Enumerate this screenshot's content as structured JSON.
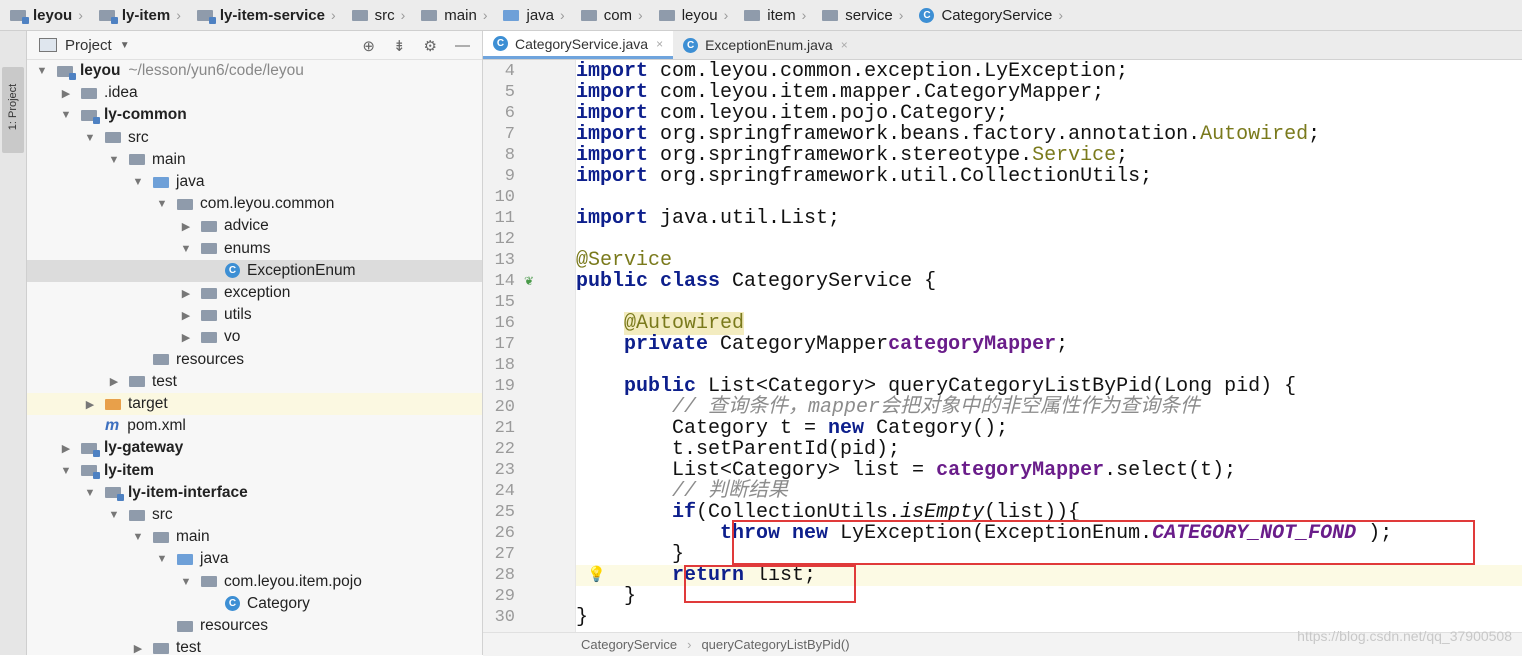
{
  "breadcrumb": [
    "leyou",
    "ly-item",
    "ly-item-service",
    "src",
    "main",
    "java",
    "com",
    "leyou",
    "item",
    "service",
    "CategoryService"
  ],
  "tool_strip": {
    "label": "1: Project"
  },
  "project_panel": {
    "title": "Project",
    "tree": [
      {
        "label": "leyou",
        "path": "~/lesson/yun6/code/leyou",
        "depth": 0,
        "arrow": "down",
        "icon": "module-folder",
        "bold": true
      },
      {
        "label": ".idea",
        "depth": 1,
        "arrow": "right",
        "icon": "folder"
      },
      {
        "label": "ly-common",
        "depth": 1,
        "arrow": "down",
        "icon": "module-folder",
        "bold": true
      },
      {
        "label": "src",
        "depth": 2,
        "arrow": "down",
        "icon": "folder"
      },
      {
        "label": "main",
        "depth": 3,
        "arrow": "down",
        "icon": "folder"
      },
      {
        "label": "java",
        "depth": 4,
        "arrow": "down",
        "icon": "source-folder"
      },
      {
        "label": "com.leyou.common",
        "depth": 5,
        "arrow": "down",
        "icon": "package"
      },
      {
        "label": "advice",
        "depth": 6,
        "arrow": "right",
        "icon": "package"
      },
      {
        "label": "enums",
        "depth": 6,
        "arrow": "down",
        "icon": "package"
      },
      {
        "label": "ExceptionEnum",
        "depth": 7,
        "arrow": "",
        "icon": "class",
        "selected": true
      },
      {
        "label": "exception",
        "depth": 6,
        "arrow": "right",
        "icon": "package"
      },
      {
        "label": "utils",
        "depth": 6,
        "arrow": "right",
        "icon": "package"
      },
      {
        "label": "vo",
        "depth": 6,
        "arrow": "right",
        "icon": "package"
      },
      {
        "label": "resources",
        "depth": 4,
        "arrow": "",
        "icon": "folder"
      },
      {
        "label": "test",
        "depth": 3,
        "arrow": "right",
        "icon": "folder"
      },
      {
        "label": "target",
        "depth": 2,
        "arrow": "right",
        "icon": "target-folder",
        "highlight": true
      },
      {
        "label": "pom.xml",
        "depth": 2,
        "arrow": "",
        "icon": "maven"
      },
      {
        "label": "ly-gateway",
        "depth": 1,
        "arrow": "right",
        "icon": "module-folder",
        "bold": true
      },
      {
        "label": "ly-item",
        "depth": 1,
        "arrow": "down",
        "icon": "module-folder",
        "bold": true
      },
      {
        "label": "ly-item-interface",
        "depth": 2,
        "arrow": "down",
        "icon": "module-folder",
        "bold": true
      },
      {
        "label": "src",
        "depth": 3,
        "arrow": "down",
        "icon": "folder"
      },
      {
        "label": "main",
        "depth": 4,
        "arrow": "down",
        "icon": "folder"
      },
      {
        "label": "java",
        "depth": 5,
        "arrow": "down",
        "icon": "source-folder"
      },
      {
        "label": "com.leyou.item.pojo",
        "depth": 6,
        "arrow": "down",
        "icon": "package"
      },
      {
        "label": "Category",
        "depth": 7,
        "arrow": "",
        "icon": "class"
      },
      {
        "label": "resources",
        "depth": 5,
        "arrow": "",
        "icon": "folder"
      },
      {
        "label": "test",
        "depth": 4,
        "arrow": "right",
        "icon": "folder"
      }
    ]
  },
  "editor": {
    "tabs": [
      {
        "label": "CategoryService.java",
        "active": true
      },
      {
        "label": "ExceptionEnum.java",
        "active": false
      }
    ],
    "lines": [
      {
        "n": "4",
        "tokens": [
          [
            "kw",
            "import"
          ],
          [
            "",
            "com.leyou.common.exception.LyException;"
          ]
        ]
      },
      {
        "n": "5",
        "tokens": [
          [
            "kw",
            "import"
          ],
          [
            "",
            "com.leyou.item.mapper.CategoryMapper;"
          ]
        ]
      },
      {
        "n": "6",
        "tokens": [
          [
            "kw",
            "import"
          ],
          [
            "",
            "com.leyou.item.pojo.Category;"
          ]
        ]
      },
      {
        "n": "7",
        "tokens": [
          [
            "kw",
            "import"
          ],
          [
            "",
            "org.springframework.beans.factory.annotation."
          ],
          [
            "ann",
            "Autowired"
          ],
          [
            "",
            ";"
          ]
        ]
      },
      {
        "n": "8",
        "tokens": [
          [
            "kw",
            "import"
          ],
          [
            "",
            "org.springframework.stereotype."
          ],
          [
            "ann",
            "Service"
          ],
          [
            "",
            ";"
          ]
        ]
      },
      {
        "n": "9",
        "tokens": [
          [
            "kw",
            "import"
          ],
          [
            "",
            "org.springframework.util.CollectionUtils;"
          ]
        ]
      },
      {
        "n": "10",
        "tokens": []
      },
      {
        "n": "11",
        "tokens": [
          [
            "kw",
            "import"
          ],
          [
            "",
            "java.util.List;"
          ]
        ]
      },
      {
        "n": "12",
        "tokens": []
      },
      {
        "n": "13",
        "tokens": [
          [
            "ann",
            "@Service"
          ]
        ]
      },
      {
        "n": "14",
        "tokens": [
          [
            "kw",
            "public class"
          ],
          [
            "",
            "CategoryService {"
          ]
        ]
      },
      {
        "n": "15",
        "tokens": []
      },
      {
        "n": "16",
        "tokens": [
          [
            "",
            "    "
          ],
          [
            "annbg",
            "@Autowired"
          ]
        ]
      },
      {
        "n": "17",
        "tokens": [
          [
            "",
            "    "
          ],
          [
            "kw",
            "private"
          ],
          [
            "",
            "CategoryMapper"
          ],
          [
            "fld",
            "categoryMapper"
          ],
          [
            "",
            ";"
          ]
        ]
      },
      {
        "n": "18",
        "tokens": []
      },
      {
        "n": "19",
        "tokens": [
          [
            "",
            "    "
          ],
          [
            "kw",
            "public"
          ],
          [
            "",
            "List<Category> queryCategoryListByPid(Long pid) {"
          ]
        ]
      },
      {
        "n": "20",
        "tokens": [
          [
            "",
            "        "
          ],
          [
            "cmt",
            "// 查询条件，mapper会把对象中的非空属性作为查询条件"
          ]
        ]
      },
      {
        "n": "21",
        "tokens": [
          [
            "",
            "        Category t = "
          ],
          [
            "kw",
            "new"
          ],
          [
            "",
            "Category();"
          ]
        ]
      },
      {
        "n": "22",
        "tokens": [
          [
            "",
            "        t.setParentId(pid);"
          ]
        ]
      },
      {
        "n": "23",
        "tokens": [
          [
            "",
            "        List<Category> list = "
          ],
          [
            "fld",
            "categoryMapper"
          ],
          [
            "",
            ".select(t);"
          ]
        ]
      },
      {
        "n": "24",
        "tokens": [
          [
            "",
            "        "
          ],
          [
            "cmt",
            "// 判断结果"
          ]
        ]
      },
      {
        "n": "25",
        "tokens": [
          [
            "",
            "        "
          ],
          [
            "kw",
            "if"
          ],
          [
            "",
            "(CollectionUtils."
          ],
          [
            "ital",
            "isEmpty"
          ],
          [
            "",
            "(list)){"
          ]
        ]
      },
      {
        "n": "26",
        "tokens": [
          [
            "",
            "            "
          ],
          [
            "kw",
            "throw new"
          ],
          [
            "",
            "LyException(ExceptionEnum."
          ],
          [
            "cst",
            "CATEGORY_NOT_FOND"
          ],
          [
            "",
            ");"
          ]
        ]
      },
      {
        "n": "27",
        "tokens": [
          [
            "",
            "        }"
          ]
        ]
      },
      {
        "n": "28",
        "tokens": [
          [
            "",
            "        "
          ],
          [
            "kw",
            "return"
          ],
          [
            "",
            "list;"
          ]
        ]
      },
      {
        "n": "29",
        "tokens": [
          [
            "",
            "    }"
          ]
        ]
      },
      {
        "n": "30",
        "tokens": [
          [
            "",
            "}"
          ]
        ]
      }
    ]
  },
  "status": {
    "crumbs": [
      "CategoryService",
      "queryCategoryListByPid()"
    ]
  },
  "watermark": "https://blog.csdn.net/qq_37900508"
}
